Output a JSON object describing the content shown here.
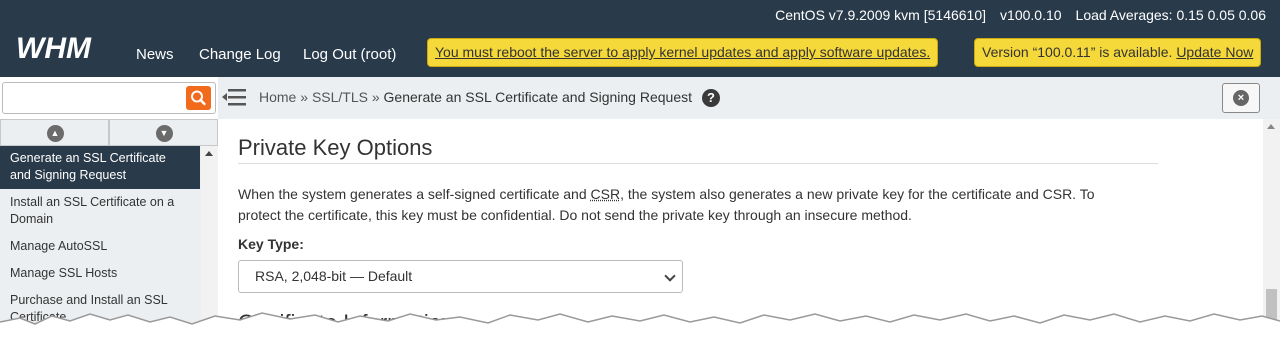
{
  "header": {
    "logo_text": "WHM",
    "os": "CentOS v7.9.2009 kvm [5146610]",
    "version": "v100.0.10",
    "load": "Load Averages: 0.15 0.05 0.06",
    "nav": [
      "News",
      "Change Log",
      "Log Out (root)"
    ],
    "reboot_notice": "You must reboot the server to apply kernel updates and apply software updates.",
    "update_prefix": "Version “100.0.11” is available.",
    "update_link": "Update Now"
  },
  "search": {
    "placeholder": "",
    "value": "",
    "icon": "search-icon"
  },
  "breadcrumb": {
    "home": "Home",
    "sep": "»",
    "section": "SSL/TLS",
    "current": "Generate an SSL Certificate and Signing Request",
    "help": "?"
  },
  "sidebar": {
    "items": [
      {
        "label": "Generate an SSL Certificate and Signing Request",
        "active": true
      },
      {
        "label": "Install an SSL Certificate on a Domain",
        "active": false
      },
      {
        "label": "Manage AutoSSL",
        "active": false
      },
      {
        "label": "Manage SSL Hosts",
        "active": false
      },
      {
        "label": "Purchase and Install an SSL Certificate",
        "active": false
      }
    ]
  },
  "main": {
    "section_title": "Private Key Options",
    "desc_part1": "When the system generates a self-signed certificate and ",
    "desc_abbr": "CSR",
    "desc_part2": ", the system also generates a new private key for the certificate and CSR. To protect the certificate, this key must be confidential. Do not send the private key through an insecure method.",
    "key_type_label": "Key Type:",
    "key_type_value": "RSA, 2,048-bit  — Default",
    "next_section_title": "Certificate Information"
  },
  "colors": {
    "topbar": "#293a4a",
    "notice": "#f5d83a",
    "search_button": "#f26a1b",
    "active_item": "#293a4a"
  }
}
